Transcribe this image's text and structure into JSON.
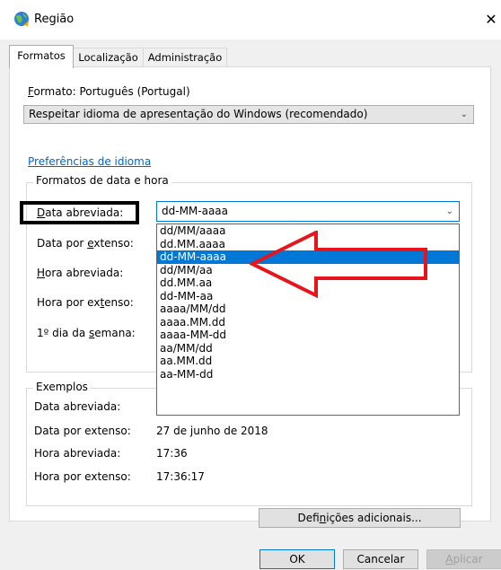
{
  "window": {
    "title": "Região",
    "close_label": "✕"
  },
  "tabs": [
    {
      "label": "Formatos",
      "active": true
    },
    {
      "label": "Localização",
      "active": false
    },
    {
      "label": "Administração",
      "active": false
    }
  ],
  "formats": {
    "format_label_key": "F",
    "format_label_rest": "ormato: Português (Portugal)",
    "format_value": "Respeitar idioma de apresentação do Windows (recomendado)",
    "pref_link": "Preferências de idioma",
    "group_title": "Formatos de data e hora",
    "fields": [
      {
        "pre": "",
        "key": "D",
        "post": "ata abreviada:"
      },
      {
        "pre": "Data por ",
        "key": "e",
        "post": "xtenso:"
      },
      {
        "pre": "",
        "key": "H",
        "post": "ora abreviada:"
      },
      {
        "pre": "Hora por ex",
        "key": "t",
        "post": "enso:"
      },
      {
        "pre": "1º dia da ",
        "key": "s",
        "post": "emana:"
      }
    ],
    "short_date_value": "dd-MM-aaaa",
    "short_date_options": [
      "dd/MM/aaaa",
      "dd.MM.aaaa",
      "dd-MM-aaaa",
      "dd/MM/aa",
      "dd.MM.aa",
      "dd-MM-aa",
      "aaaa/MM/dd",
      "aaaa.MM.dd",
      "aaaa-MM-dd",
      "aa/MM/dd",
      "aa.MM.dd",
      "aa-MM-dd"
    ],
    "selected_index": 2
  },
  "examples": {
    "title": "Exemplos",
    "rows": [
      {
        "label": "Data abreviada:",
        "value": ""
      },
      {
        "label": "Data por extenso:",
        "value": "27 de junho de 2018"
      },
      {
        "label": "Hora abreviada:",
        "value": "17:36"
      },
      {
        "label": "Hora por extenso:",
        "value": "17:36:17"
      }
    ]
  },
  "buttons": {
    "more_pre": "Defi",
    "more_key": "n",
    "more_post": "ições adicionais...",
    "ok": "OK",
    "cancel": "Cancelar",
    "apply_key": "A",
    "apply_post": "plicar"
  },
  "colors": {
    "accent": "#0078d7",
    "link": "#0066cc",
    "annotation": "#e8141c"
  }
}
